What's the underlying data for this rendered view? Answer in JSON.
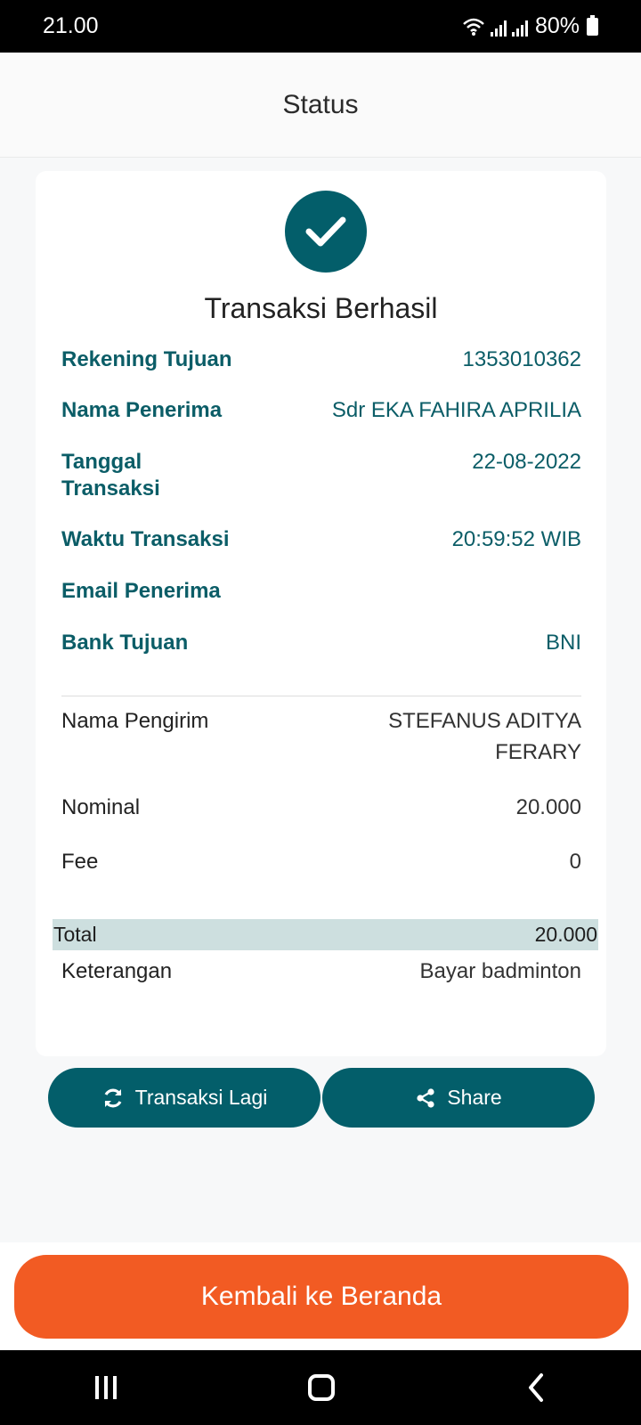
{
  "status_bar": {
    "time": "21.00",
    "battery": "80%"
  },
  "header": {
    "title": "Status"
  },
  "card": {
    "title": "Transaksi Berhasil",
    "recipient_rows": [
      {
        "label": "Rekening Tujuan",
        "value": "1353010362"
      },
      {
        "label": "Nama Penerima",
        "value": "Sdr EKA FAHIRA APRILIA"
      },
      {
        "label": "Tanggal Transaksi",
        "value": "22-08-2022"
      },
      {
        "label": "Waktu Transaksi",
        "value": "20:59:52 WIB"
      },
      {
        "label": "Email Penerima",
        "value": ""
      },
      {
        "label": "Bank Tujuan",
        "value": "BNI"
      }
    ],
    "sender_rows": [
      {
        "label": "Nama Pengirim",
        "value": "STEFANUS ADITYA FERARY"
      },
      {
        "label": "Nominal",
        "value": "20.000"
      },
      {
        "label": "Fee",
        "value": "0"
      }
    ],
    "total": {
      "label": "Total",
      "value": "20.000"
    },
    "note": {
      "label": "Keterangan",
      "value": "Bayar badminton"
    }
  },
  "actions": {
    "again_label": "Transaksi Lagi",
    "share_label": "Share"
  },
  "footer": {
    "home_label": "Kembali ke Beranda"
  },
  "colors": {
    "primary": "#035e6a",
    "accent": "#f25b23",
    "total_bg": "#cddfdf"
  },
  "icons": {
    "success": "check-icon",
    "again": "refresh-icon",
    "share": "share-icon"
  }
}
